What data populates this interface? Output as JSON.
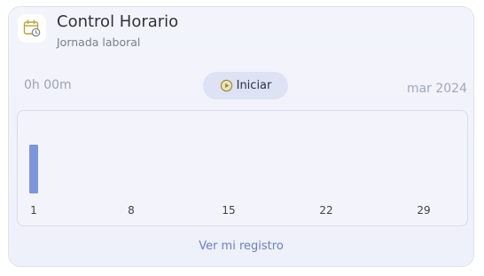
{
  "header": {
    "icon": "calendar-clock-icon",
    "title": "Control Horario",
    "subtitle": "Jornada laboral"
  },
  "timer": {
    "duration": "0h 00m",
    "start_label": "Iniciar",
    "start_icon": "play-circle-icon",
    "period": "mar 2024"
  },
  "colors": {
    "bar": "#7b96dd",
    "accent_icon": "#b9a53a",
    "link": "#6b80c7"
  },
  "chart_data": {
    "type": "bar",
    "x": [
      1,
      2,
      3,
      4,
      5,
      6,
      7,
      8,
      9,
      10,
      11,
      12,
      13,
      14,
      15,
      16,
      17,
      18,
      19,
      20,
      21,
      22,
      23,
      24,
      25,
      26,
      27,
      28,
      29,
      30,
      31
    ],
    "values": [
      1,
      0,
      0,
      0,
      0,
      0,
      0,
      0,
      0,
      0,
      0,
      0,
      0,
      0,
      0,
      0,
      0,
      0,
      0,
      0,
      0,
      0,
      0,
      0,
      0,
      0,
      0,
      0,
      0,
      0,
      0
    ],
    "xticks": [
      "1",
      "8",
      "15",
      "22",
      "29"
    ],
    "ylim": [
      0,
      1
    ],
    "grid": false
  },
  "footer": {
    "link_label": "Ver mi registro"
  }
}
